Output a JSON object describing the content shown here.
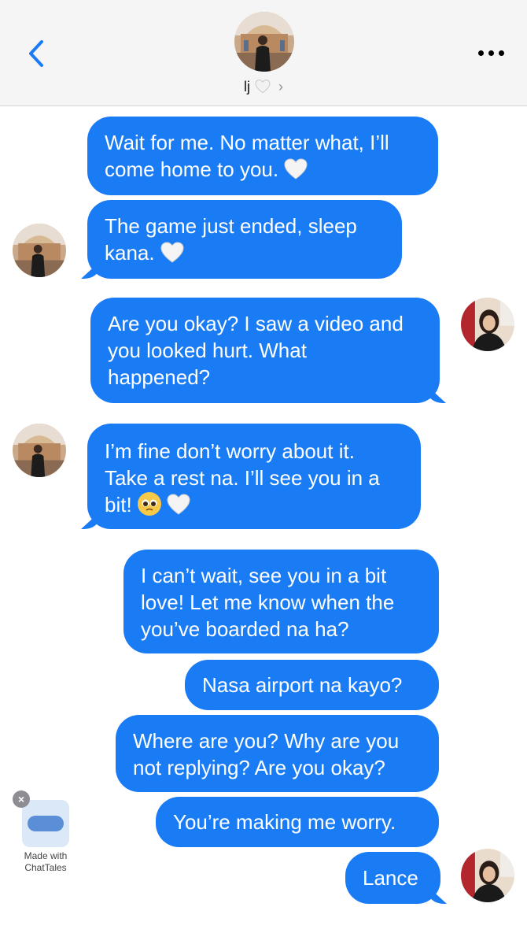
{
  "header": {
    "contact_name": "lj",
    "back_icon": "chevron-left-icon",
    "more_icon": "ellipsis-icon",
    "accent_color": "#1a7cf5"
  },
  "messages": [
    {
      "side": "sent",
      "lines": [
        "Wait for me. No matter what, I’ll",
        "come home to you."
      ],
      "trailing_emoji": [
        "white-heart"
      ]
    },
    {
      "side": "received",
      "lines": [
        "The game just ended, sleep",
        "kana."
      ],
      "trailing_emoji": [
        "white-heart"
      ]
    },
    {
      "side": "sent",
      "lines": [
        "Are you okay? I saw a video and",
        "you looked hurt. What",
        "happened?"
      ]
    },
    {
      "side": "received",
      "lines": [
        "I’m fine don’t worry about it.",
        "Take a rest na. I’ll see you in a",
        "bit!"
      ],
      "trailing_emoji": [
        "pleading-face",
        "white-heart"
      ]
    },
    {
      "side": "sent",
      "lines": [
        "I can’t wait, see you in a bit",
        "love! Let me know when the",
        "you’ve boarded na ha?"
      ]
    },
    {
      "side": "sent",
      "lines": [
        "Nasa airport na kayo?"
      ]
    },
    {
      "side": "sent",
      "lines": [
        "Where are you? Why are you",
        "not replying? Are you okay?"
      ]
    },
    {
      "side": "sent",
      "lines": [
        "You’re making me worry."
      ]
    },
    {
      "side": "sent",
      "lines": [
        "Lance"
      ]
    }
  ],
  "watermark": {
    "line1": "Made with",
    "line2": "ChatTales"
  }
}
